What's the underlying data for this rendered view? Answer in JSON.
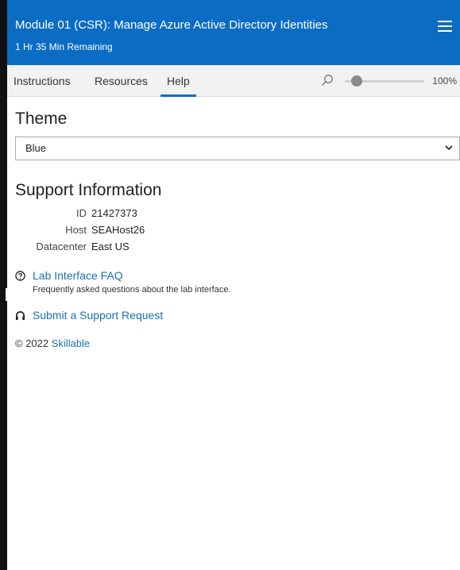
{
  "header": {
    "title": "Module 01 (CSR): Manage Azure Active Directory Identities",
    "timer": "1 Hr 35 Min Remaining"
  },
  "tabs": [
    {
      "label": "Instructions",
      "active": false
    },
    {
      "label": "Resources",
      "active": false
    },
    {
      "label": "Help",
      "active": true
    }
  ],
  "zoom": {
    "value": "100%",
    "level_fraction": 0.15
  },
  "theme": {
    "title": "Theme",
    "selected": "Blue"
  },
  "support": {
    "title": "Support Information",
    "rows": [
      {
        "key": "ID",
        "value": "21427373"
      },
      {
        "key": "Host",
        "value": "SEAHost26"
      },
      {
        "key": "Datacenter",
        "value": "East US"
      }
    ]
  },
  "faq": {
    "label": "Lab Interface FAQ",
    "description": "Frequently asked questions about the lab interface.",
    "icon": "question-circle-icon"
  },
  "support_request": {
    "label": "Submit a Support Request",
    "icon": "headset-icon"
  },
  "footer": {
    "copyright": "© 2022",
    "brand": "Skillable"
  },
  "colors": {
    "accent": "#0b6cc4",
    "link": "#1a6fb3"
  }
}
